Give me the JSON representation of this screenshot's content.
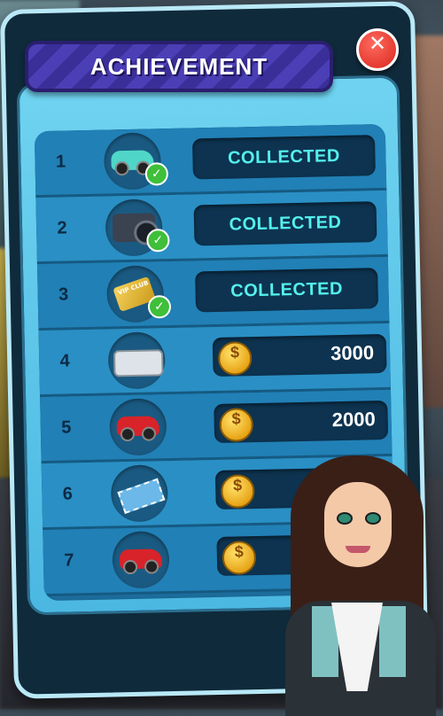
{
  "header": {
    "title": "ACHIEVEMENT",
    "close_icon": "close-x-icon"
  },
  "achievements": [
    {
      "number": "1",
      "item": "car-icon",
      "status": "COLLECTED",
      "collected": true
    },
    {
      "number": "2",
      "item": "camera-icon",
      "status": "COLLECTED",
      "collected": true
    },
    {
      "number": "3",
      "item": "vip-card-icon",
      "status": "COLLECTED",
      "collected": true
    },
    {
      "number": "4",
      "item": "camcorder-icon",
      "price": "3000",
      "coin_symbol": "$",
      "collected": false
    },
    {
      "number": "5",
      "item": "car-icon",
      "price": "2000",
      "coin_symbol": "$",
      "collected": false
    },
    {
      "number": "6",
      "item": "ticket-icon",
      "coin_symbol": "$",
      "collected": false
    },
    {
      "number": "7",
      "item": "car-icon",
      "coin_symbol": "$",
      "collected": false
    }
  ],
  "vip_card_text": "VIP CLUB",
  "colors": {
    "status_text": "#54f0ec",
    "panel_border": "#b9e8f7",
    "title_bar": "#4b3fb6",
    "close_button": "#d9261d"
  }
}
